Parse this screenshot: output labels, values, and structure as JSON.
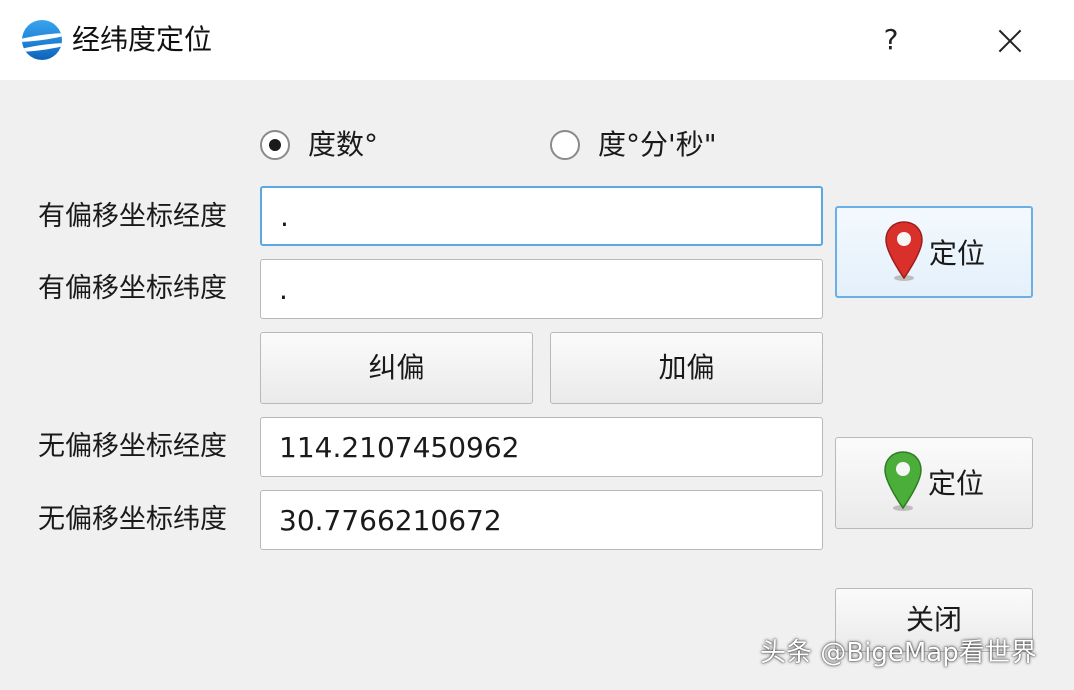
{
  "window": {
    "title": "经纬度定位",
    "help_label": "?",
    "app_icon": "globe-logo-icon",
    "close_icon": "close-icon"
  },
  "format": {
    "options": [
      {
        "label": "度数°",
        "selected": true
      },
      {
        "label": "度°分'秒\"",
        "selected": false
      }
    ]
  },
  "offset": {
    "lon_label": "有偏移坐标经度",
    "lon_value": ".",
    "lat_label": "有偏移坐标纬度",
    "lat_value": ".",
    "locate_label": "定位",
    "pin_color": "#d9302c"
  },
  "actions": {
    "correct_label": "纠偏",
    "add_offset_label": "加偏"
  },
  "nooffset": {
    "lon_label": "无偏移坐标经度",
    "lon_value": "114.2107450962",
    "lat_label": "无偏移坐标纬度",
    "lat_value": "30.7766210672",
    "locate_label": "定位",
    "pin_color": "#4cae3a"
  },
  "footer": {
    "close_label": "关闭"
  },
  "watermark": "头条 @BigeMap看世界",
  "colors": {
    "focus_border": "#5aa8e0",
    "window_bg": "#f0f0f0"
  }
}
